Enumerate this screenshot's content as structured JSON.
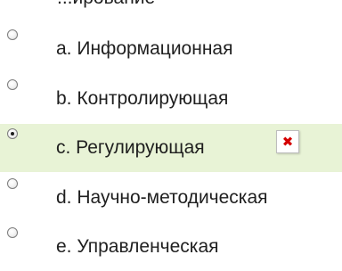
{
  "question": {
    "top_fragment": "...ирование"
  },
  "options": [
    {
      "letter": "a.",
      "label": "a. Информационная",
      "selected": false
    },
    {
      "letter": "b.",
      "label": "b. Контролирующая",
      "selected": false
    },
    {
      "letter": "c.",
      "label": "c. Регулирующая",
      "selected": true
    },
    {
      "letter": "d.",
      "label": "d. Научно-методическая",
      "selected": false
    },
    {
      "letter": "e.",
      "label": "e. Управленческая",
      "selected": false
    }
  ],
  "icons": {
    "broken_image": "broken-image-icon",
    "radio": "radio-button-icon"
  },
  "colors": {
    "selected_row_background": "#e8f3d6",
    "text": "#1f1f1f",
    "broken_image_mark": "#d40000"
  }
}
